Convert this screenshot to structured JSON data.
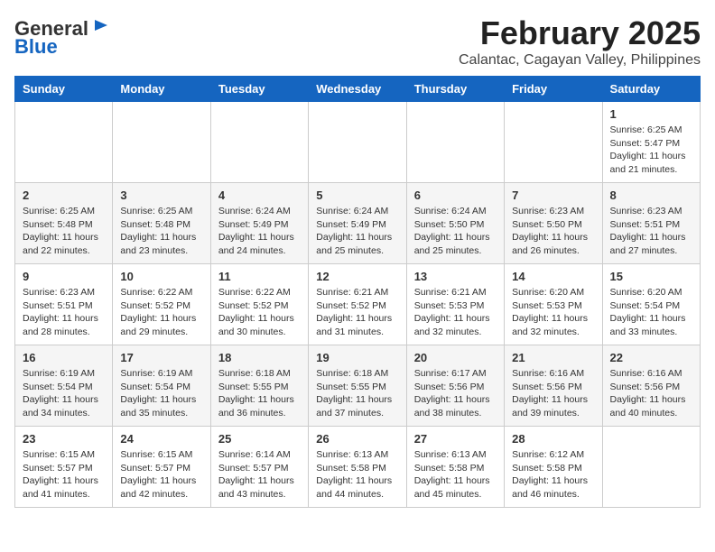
{
  "header": {
    "logo_general": "General",
    "logo_blue": "Blue",
    "month_year": "February 2025",
    "location": "Calantac, Cagayan Valley, Philippines"
  },
  "weekdays": [
    "Sunday",
    "Monday",
    "Tuesday",
    "Wednesday",
    "Thursday",
    "Friday",
    "Saturday"
  ],
  "weeks": [
    [
      {
        "day": "",
        "text": ""
      },
      {
        "day": "",
        "text": ""
      },
      {
        "day": "",
        "text": ""
      },
      {
        "day": "",
        "text": ""
      },
      {
        "day": "",
        "text": ""
      },
      {
        "day": "",
        "text": ""
      },
      {
        "day": "1",
        "text": "Sunrise: 6:25 AM\nSunset: 5:47 PM\nDaylight: 11 hours\nand 21 minutes."
      }
    ],
    [
      {
        "day": "2",
        "text": "Sunrise: 6:25 AM\nSunset: 5:48 PM\nDaylight: 11 hours\nand 22 minutes."
      },
      {
        "day": "3",
        "text": "Sunrise: 6:25 AM\nSunset: 5:48 PM\nDaylight: 11 hours\nand 23 minutes."
      },
      {
        "day": "4",
        "text": "Sunrise: 6:24 AM\nSunset: 5:49 PM\nDaylight: 11 hours\nand 24 minutes."
      },
      {
        "day": "5",
        "text": "Sunrise: 6:24 AM\nSunset: 5:49 PM\nDaylight: 11 hours\nand 25 minutes."
      },
      {
        "day": "6",
        "text": "Sunrise: 6:24 AM\nSunset: 5:50 PM\nDaylight: 11 hours\nand 25 minutes."
      },
      {
        "day": "7",
        "text": "Sunrise: 6:23 AM\nSunset: 5:50 PM\nDaylight: 11 hours\nand 26 minutes."
      },
      {
        "day": "8",
        "text": "Sunrise: 6:23 AM\nSunset: 5:51 PM\nDaylight: 11 hours\nand 27 minutes."
      }
    ],
    [
      {
        "day": "9",
        "text": "Sunrise: 6:23 AM\nSunset: 5:51 PM\nDaylight: 11 hours\nand 28 minutes."
      },
      {
        "day": "10",
        "text": "Sunrise: 6:22 AM\nSunset: 5:52 PM\nDaylight: 11 hours\nand 29 minutes."
      },
      {
        "day": "11",
        "text": "Sunrise: 6:22 AM\nSunset: 5:52 PM\nDaylight: 11 hours\nand 30 minutes."
      },
      {
        "day": "12",
        "text": "Sunrise: 6:21 AM\nSunset: 5:52 PM\nDaylight: 11 hours\nand 31 minutes."
      },
      {
        "day": "13",
        "text": "Sunrise: 6:21 AM\nSunset: 5:53 PM\nDaylight: 11 hours\nand 32 minutes."
      },
      {
        "day": "14",
        "text": "Sunrise: 6:20 AM\nSunset: 5:53 PM\nDaylight: 11 hours\nand 32 minutes."
      },
      {
        "day": "15",
        "text": "Sunrise: 6:20 AM\nSunset: 5:54 PM\nDaylight: 11 hours\nand 33 minutes."
      }
    ],
    [
      {
        "day": "16",
        "text": "Sunrise: 6:19 AM\nSunset: 5:54 PM\nDaylight: 11 hours\nand 34 minutes."
      },
      {
        "day": "17",
        "text": "Sunrise: 6:19 AM\nSunset: 5:54 PM\nDaylight: 11 hours\nand 35 minutes."
      },
      {
        "day": "18",
        "text": "Sunrise: 6:18 AM\nSunset: 5:55 PM\nDaylight: 11 hours\nand 36 minutes."
      },
      {
        "day": "19",
        "text": "Sunrise: 6:18 AM\nSunset: 5:55 PM\nDaylight: 11 hours\nand 37 minutes."
      },
      {
        "day": "20",
        "text": "Sunrise: 6:17 AM\nSunset: 5:56 PM\nDaylight: 11 hours\nand 38 minutes."
      },
      {
        "day": "21",
        "text": "Sunrise: 6:16 AM\nSunset: 5:56 PM\nDaylight: 11 hours\nand 39 minutes."
      },
      {
        "day": "22",
        "text": "Sunrise: 6:16 AM\nSunset: 5:56 PM\nDaylight: 11 hours\nand 40 minutes."
      }
    ],
    [
      {
        "day": "23",
        "text": "Sunrise: 6:15 AM\nSunset: 5:57 PM\nDaylight: 11 hours\nand 41 minutes."
      },
      {
        "day": "24",
        "text": "Sunrise: 6:15 AM\nSunset: 5:57 PM\nDaylight: 11 hours\nand 42 minutes."
      },
      {
        "day": "25",
        "text": "Sunrise: 6:14 AM\nSunset: 5:57 PM\nDaylight: 11 hours\nand 43 minutes."
      },
      {
        "day": "26",
        "text": "Sunrise: 6:13 AM\nSunset: 5:58 PM\nDaylight: 11 hours\nand 44 minutes."
      },
      {
        "day": "27",
        "text": "Sunrise: 6:13 AM\nSunset: 5:58 PM\nDaylight: 11 hours\nand 45 minutes."
      },
      {
        "day": "28",
        "text": "Sunrise: 6:12 AM\nSunset: 5:58 PM\nDaylight: 11 hours\nand 46 minutes."
      },
      {
        "day": "",
        "text": ""
      }
    ]
  ]
}
